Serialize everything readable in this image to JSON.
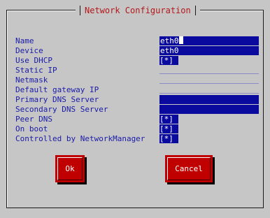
{
  "dialog": {
    "title": "Network Configuration"
  },
  "fields": [
    {
      "label": "Name",
      "value": "eth0",
      "type": "text",
      "cursor": true
    },
    {
      "label": "Device",
      "value": "eth0",
      "type": "text"
    },
    {
      "label": "Use DHCP",
      "value": "[*]",
      "type": "checkbox"
    },
    {
      "label": "Static IP",
      "value": "",
      "type": "text-empty"
    },
    {
      "label": "Netmask",
      "value": "",
      "type": "text-empty"
    },
    {
      "label": "Default gateway IP",
      "value": "",
      "type": "text-empty"
    },
    {
      "label": "Primary DNS Server",
      "value": "",
      "type": "text"
    },
    {
      "label": "Secondary DNS Server",
      "value": "",
      "type": "text"
    },
    {
      "label": "Peer DNS",
      "value": "[*]",
      "type": "checkbox"
    },
    {
      "label": "On boot",
      "value": "[*]",
      "type": "checkbox"
    },
    {
      "label": "Controlled by NetworkManager",
      "value": "[*]",
      "type": "checkbox"
    }
  ],
  "buttons": {
    "ok": "Ok",
    "cancel": "Cancel"
  },
  "colors": {
    "background": "#c6c6c6",
    "label": "#1a1aa8",
    "field": "#0a0a9e",
    "button": "#c00000",
    "title": "#b3181a"
  }
}
